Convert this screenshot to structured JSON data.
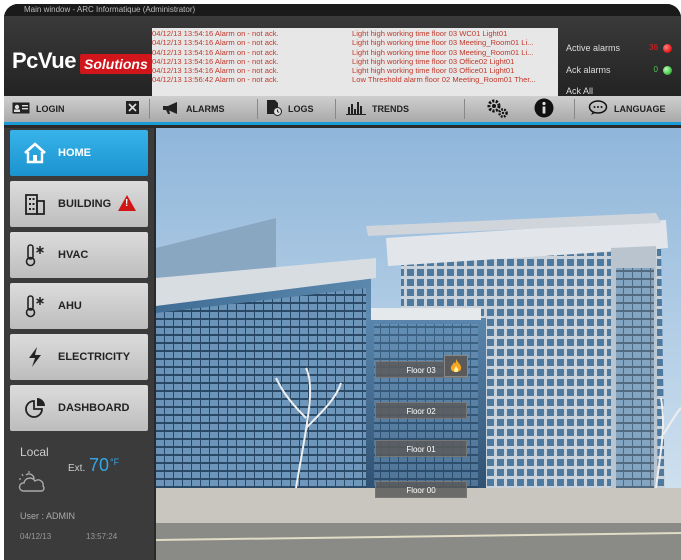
{
  "window": {
    "title": "Main window - ARC Informatique (Administrator)"
  },
  "logo": {
    "brand": "PcVue",
    "tagline": "Solutions"
  },
  "alarms": {
    "rows": [
      {
        "time": "04/12/13 13:54:16  Alarm on - not ack.",
        "text": "Light high working time floor 03 WC01 Light01"
      },
      {
        "time": "04/12/13 13:54:16  Alarm on - not ack.",
        "text": "Light high working time floor 03 Meeting_Room01 Li..."
      },
      {
        "time": "04/12/13 13:54:16  Alarm on - not ack.",
        "text": "Light high working time floor 03 Meeting_Room01 Li..."
      },
      {
        "time": "04/12/13 13:54:16  Alarm on - not ack.",
        "text": "Light high working time floor 03 Office02 Light01"
      },
      {
        "time": "04/12/13 13:54:16  Alarm on - not ack.",
        "text": "Light high working time floor 03 Office01 Light01"
      },
      {
        "time": "04/12/13 13:56:42  Alarm on - not ack.",
        "text": "Low Threshold alarm floor 02 Meeting_Room01 Ther..."
      }
    ]
  },
  "alarm_status": {
    "active_label": "Active alarms",
    "active_count": "36",
    "ack_label": "Ack alarms",
    "ack_count": "0",
    "ack_all_label": "Ack All"
  },
  "toolbar": {
    "login": "LOGIN",
    "alarms": "ALARMS",
    "logs": "LOGS",
    "trends": "TRENDS",
    "language": "LANGUAGE"
  },
  "nav": {
    "home": "HOME",
    "building": "BUILDING",
    "hvac": "HVAC",
    "ahu": "AHU",
    "electricity": "ELECTRICITY",
    "dashboard": "DASHBOARD"
  },
  "weather": {
    "local_label": "Local",
    "ext_label": "Ext.",
    "temperature": "70",
    "unit": "°F",
    "user_label": "User :  ADMIN",
    "date": "04/12/13",
    "time": "13:57:24"
  },
  "floors": [
    "Floor 03",
    "Floor 02",
    "Floor 01",
    "Floor 00"
  ],
  "colors": {
    "accent": "#1a9ad6",
    "alarm_red": "#c0392b",
    "active_dot": "#e82020",
    "ack_dot": "#4cc84c"
  }
}
